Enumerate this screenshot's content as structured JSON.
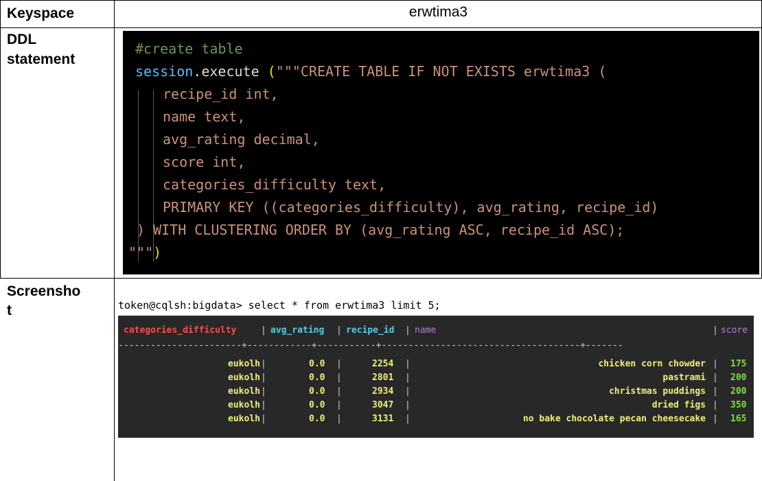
{
  "keyspace_row": {
    "label": "Keyspace",
    "value": "erwtima3"
  },
  "ddl_row": {
    "label_line1": "DDL",
    "label_line2": "statement",
    "code": {
      "comment": "#create table",
      "obj": "session",
      "dot": ".",
      "method": "execute",
      "open": " (",
      "open_str": "\"\"\"CREATE TABLE IF NOT EXISTS erwtima3 (",
      "cols": [
        "recipe_id int,",
        "name text,",
        "avg_rating decimal,",
        "score int,",
        "categories_difficulty text,",
        "PRIMARY KEY ((categories_difficulty), avg_rating, recipe_id)"
      ],
      "clustering": ") WITH CLUSTERING ORDER BY (avg_rating ASC, recipe_id ASC);",
      "close_str": "\"\"\"",
      "close_paren": ")"
    }
  },
  "screenshot_row": {
    "label_line1": "Screensho",
    "label_line2": "t",
    "prompt": "token@cqlsh:bigdata> select * from erwtima3 limit 5;",
    "columns": [
      "categories_difficulty",
      "avg_rating",
      "recipe_id",
      "name",
      "score"
    ],
    "separator": "-----------------------+------------+-----------+-------------------------------------+-------",
    "rows": [
      {
        "categories_difficulty": "eukolh",
        "avg_rating": "0.0",
        "recipe_id": "2254",
        "name": "chicken corn chowder",
        "score": "175"
      },
      {
        "categories_difficulty": "eukolh",
        "avg_rating": "0.0",
        "recipe_id": "2801",
        "name": "pastrami",
        "score": "200"
      },
      {
        "categories_difficulty": "eukolh",
        "avg_rating": "0.0",
        "recipe_id": "2934",
        "name": "christmas puddings",
        "score": "200"
      },
      {
        "categories_difficulty": "eukolh",
        "avg_rating": "0.0",
        "recipe_id": "3047",
        "name": "dried figs",
        "score": "350"
      },
      {
        "categories_difficulty": "eukolh",
        "avg_rating": "0.0",
        "recipe_id": "3131",
        "name": "no bake chocolate pecan cheesecake",
        "score": "165"
      }
    ]
  },
  "colors": {
    "editor_bg": "#000000",
    "terminal_bg": "#282828",
    "col_categories": "#ff4b4b",
    "col_numeric_header": "#4fd0e8",
    "col_name_header": "#b57ed8",
    "cell_text": "#f0f07a",
    "score_text": "#7ee03e"
  }
}
